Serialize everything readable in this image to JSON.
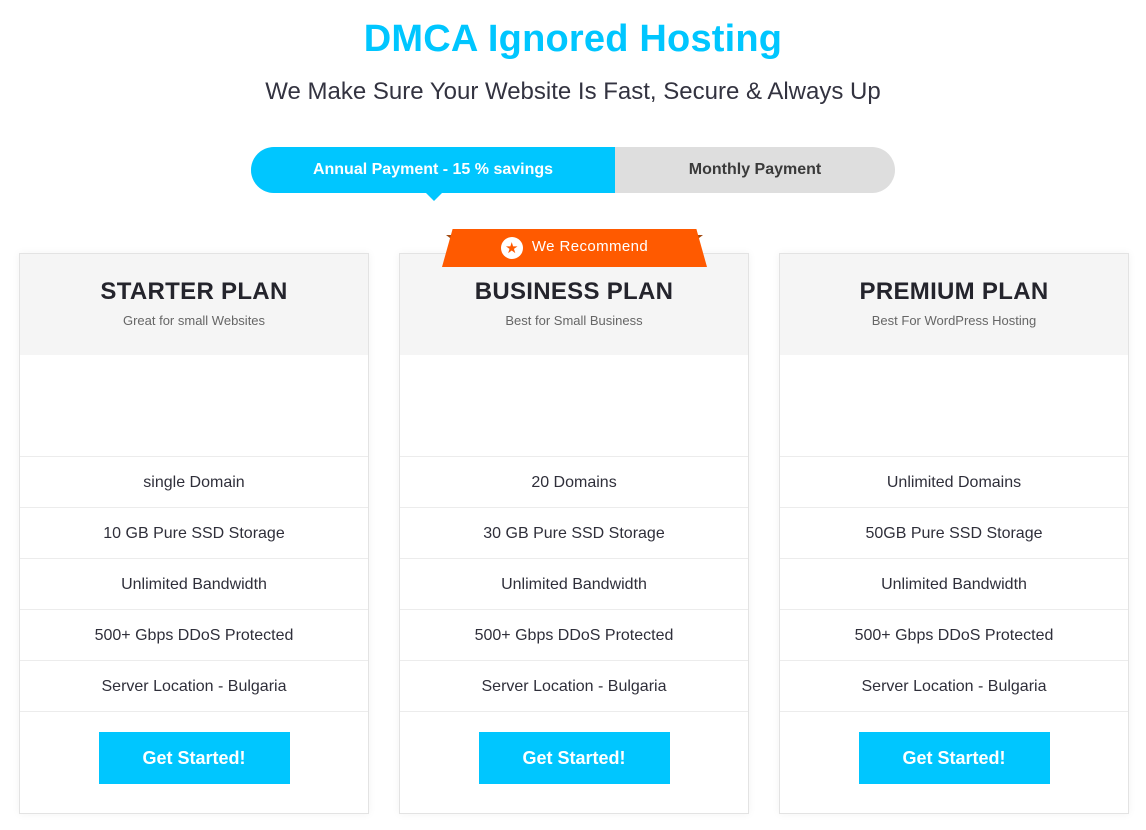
{
  "header": {
    "title": "DMCA Ignored Hosting",
    "subtitle": "We Make Sure Your Website Is Fast, Secure & Always Up"
  },
  "billing_toggle": {
    "options": [
      {
        "label": "Annual Payment - 15 % savings",
        "selected": true
      },
      {
        "label": "Monthly Payment",
        "selected": false
      }
    ]
  },
  "ribbon": {
    "icon": "star-icon",
    "label": "We Recommend"
  },
  "colors": {
    "accent": "#00c6ff",
    "ribbon": "#ff5a00",
    "card_header_bg": "#f5f5f5"
  },
  "plans": [
    {
      "name": "STARTER PLAN",
      "tagline": "Great for small Websites",
      "features": [
        "single Domain",
        "10 GB Pure SSD Storage",
        "Unlimited Bandwidth",
        "500+ Gbps DDoS Protected",
        "Server Location - Bulgaria"
      ],
      "cta": "Get Started!"
    },
    {
      "name": "BUSINESS PLAN",
      "tagline": "Best for Small Business",
      "features": [
        "20 Domains",
        "30 GB Pure SSD Storage",
        "Unlimited Bandwidth",
        "500+ Gbps DDoS Protected",
        "Server Location - Bulgaria"
      ],
      "cta": "Get Started!",
      "recommended": true
    },
    {
      "name": "PREMIUM PLAN",
      "tagline": "Best For WordPress Hosting",
      "features": [
        "Unlimited Domains",
        "50GB Pure SSD Storage",
        "Unlimited Bandwidth",
        "500+ Gbps DDoS Protected",
        "Server Location - Bulgaria"
      ],
      "cta": "Get Started!"
    }
  ]
}
